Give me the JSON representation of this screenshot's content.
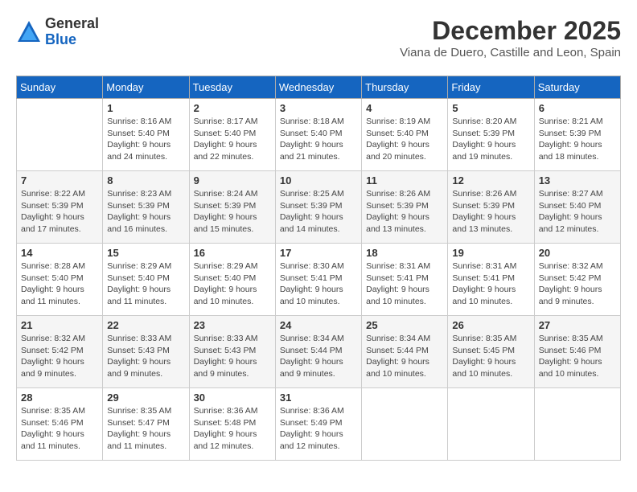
{
  "logo": {
    "general": "General",
    "blue": "Blue"
  },
  "header": {
    "month": "December 2025",
    "location": "Viana de Duero, Castille and Leon, Spain"
  },
  "weekdays": [
    "Sunday",
    "Monday",
    "Tuesday",
    "Wednesday",
    "Thursday",
    "Friday",
    "Saturday"
  ],
  "weeks": [
    [
      {
        "day": "",
        "info": ""
      },
      {
        "day": "1",
        "info": "Sunrise: 8:16 AM\nSunset: 5:40 PM\nDaylight: 9 hours\nand 24 minutes."
      },
      {
        "day": "2",
        "info": "Sunrise: 8:17 AM\nSunset: 5:40 PM\nDaylight: 9 hours\nand 22 minutes."
      },
      {
        "day": "3",
        "info": "Sunrise: 8:18 AM\nSunset: 5:40 PM\nDaylight: 9 hours\nand 21 minutes."
      },
      {
        "day": "4",
        "info": "Sunrise: 8:19 AM\nSunset: 5:40 PM\nDaylight: 9 hours\nand 20 minutes."
      },
      {
        "day": "5",
        "info": "Sunrise: 8:20 AM\nSunset: 5:39 PM\nDaylight: 9 hours\nand 19 minutes."
      },
      {
        "day": "6",
        "info": "Sunrise: 8:21 AM\nSunset: 5:39 PM\nDaylight: 9 hours\nand 18 minutes."
      }
    ],
    [
      {
        "day": "7",
        "info": "Sunrise: 8:22 AM\nSunset: 5:39 PM\nDaylight: 9 hours\nand 17 minutes."
      },
      {
        "day": "8",
        "info": "Sunrise: 8:23 AM\nSunset: 5:39 PM\nDaylight: 9 hours\nand 16 minutes."
      },
      {
        "day": "9",
        "info": "Sunrise: 8:24 AM\nSunset: 5:39 PM\nDaylight: 9 hours\nand 15 minutes."
      },
      {
        "day": "10",
        "info": "Sunrise: 8:25 AM\nSunset: 5:39 PM\nDaylight: 9 hours\nand 14 minutes."
      },
      {
        "day": "11",
        "info": "Sunrise: 8:26 AM\nSunset: 5:39 PM\nDaylight: 9 hours\nand 13 minutes."
      },
      {
        "day": "12",
        "info": "Sunrise: 8:26 AM\nSunset: 5:39 PM\nDaylight: 9 hours\nand 13 minutes."
      },
      {
        "day": "13",
        "info": "Sunrise: 8:27 AM\nSunset: 5:40 PM\nDaylight: 9 hours\nand 12 minutes."
      }
    ],
    [
      {
        "day": "14",
        "info": "Sunrise: 8:28 AM\nSunset: 5:40 PM\nDaylight: 9 hours\nand 11 minutes."
      },
      {
        "day": "15",
        "info": "Sunrise: 8:29 AM\nSunset: 5:40 PM\nDaylight: 9 hours\nand 11 minutes."
      },
      {
        "day": "16",
        "info": "Sunrise: 8:29 AM\nSunset: 5:40 PM\nDaylight: 9 hours\nand 10 minutes."
      },
      {
        "day": "17",
        "info": "Sunrise: 8:30 AM\nSunset: 5:41 PM\nDaylight: 9 hours\nand 10 minutes."
      },
      {
        "day": "18",
        "info": "Sunrise: 8:31 AM\nSunset: 5:41 PM\nDaylight: 9 hours\nand 10 minutes."
      },
      {
        "day": "19",
        "info": "Sunrise: 8:31 AM\nSunset: 5:41 PM\nDaylight: 9 hours\nand 10 minutes."
      },
      {
        "day": "20",
        "info": "Sunrise: 8:32 AM\nSunset: 5:42 PM\nDaylight: 9 hours\nand 9 minutes."
      }
    ],
    [
      {
        "day": "21",
        "info": "Sunrise: 8:32 AM\nSunset: 5:42 PM\nDaylight: 9 hours\nand 9 minutes."
      },
      {
        "day": "22",
        "info": "Sunrise: 8:33 AM\nSunset: 5:43 PM\nDaylight: 9 hours\nand 9 minutes."
      },
      {
        "day": "23",
        "info": "Sunrise: 8:33 AM\nSunset: 5:43 PM\nDaylight: 9 hours\nand 9 minutes."
      },
      {
        "day": "24",
        "info": "Sunrise: 8:34 AM\nSunset: 5:44 PM\nDaylight: 9 hours\nand 9 minutes."
      },
      {
        "day": "25",
        "info": "Sunrise: 8:34 AM\nSunset: 5:44 PM\nDaylight: 9 hours\nand 10 minutes."
      },
      {
        "day": "26",
        "info": "Sunrise: 8:35 AM\nSunset: 5:45 PM\nDaylight: 9 hours\nand 10 minutes."
      },
      {
        "day": "27",
        "info": "Sunrise: 8:35 AM\nSunset: 5:46 PM\nDaylight: 9 hours\nand 10 minutes."
      }
    ],
    [
      {
        "day": "28",
        "info": "Sunrise: 8:35 AM\nSunset: 5:46 PM\nDaylight: 9 hours\nand 11 minutes."
      },
      {
        "day": "29",
        "info": "Sunrise: 8:35 AM\nSunset: 5:47 PM\nDaylight: 9 hours\nand 11 minutes."
      },
      {
        "day": "30",
        "info": "Sunrise: 8:36 AM\nSunset: 5:48 PM\nDaylight: 9 hours\nand 12 minutes."
      },
      {
        "day": "31",
        "info": "Sunrise: 8:36 AM\nSunset: 5:49 PM\nDaylight: 9 hours\nand 12 minutes."
      },
      {
        "day": "",
        "info": ""
      },
      {
        "day": "",
        "info": ""
      },
      {
        "day": "",
        "info": ""
      }
    ]
  ]
}
